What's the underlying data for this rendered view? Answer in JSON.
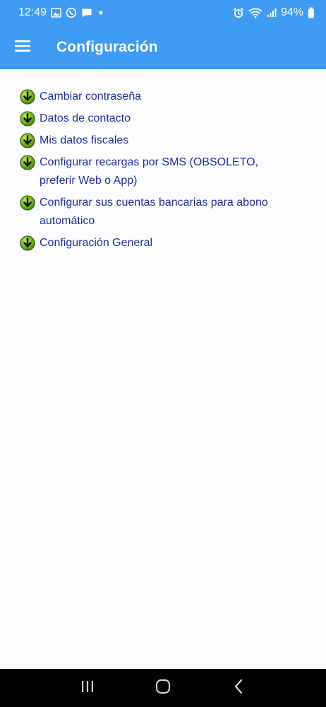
{
  "status_bar": {
    "time": "12:49",
    "battery": "94%",
    "left_icons": [
      "gallery-icon",
      "whatsapp-icon",
      "message-icon",
      "dot-icon"
    ],
    "right_icons": [
      "alarm-icon",
      "wifi-icon",
      "signal-icon",
      "battery-icon"
    ]
  },
  "app_bar": {
    "title": "Configuración",
    "menu_icon": "hamburger-menu-icon",
    "color": "#3f9cf2"
  },
  "menu": {
    "icon": "green-down-arrow-icon",
    "text_color": "#1f2f9c",
    "items": [
      {
        "label": "Cambiar contraseña"
      },
      {
        "label": "Datos de contacto"
      },
      {
        "label": "Mis datos fiscales"
      },
      {
        "label": "Configurar recargas por SMS (OBSOLETO, preferir Web o App)"
      },
      {
        "label": "Configurar sus cuentas bancarias para abono automático"
      },
      {
        "label": "Configuración General"
      }
    ]
  },
  "nav_bar": {
    "buttons": [
      "recent-apps-icon",
      "home-icon",
      "back-icon"
    ]
  }
}
